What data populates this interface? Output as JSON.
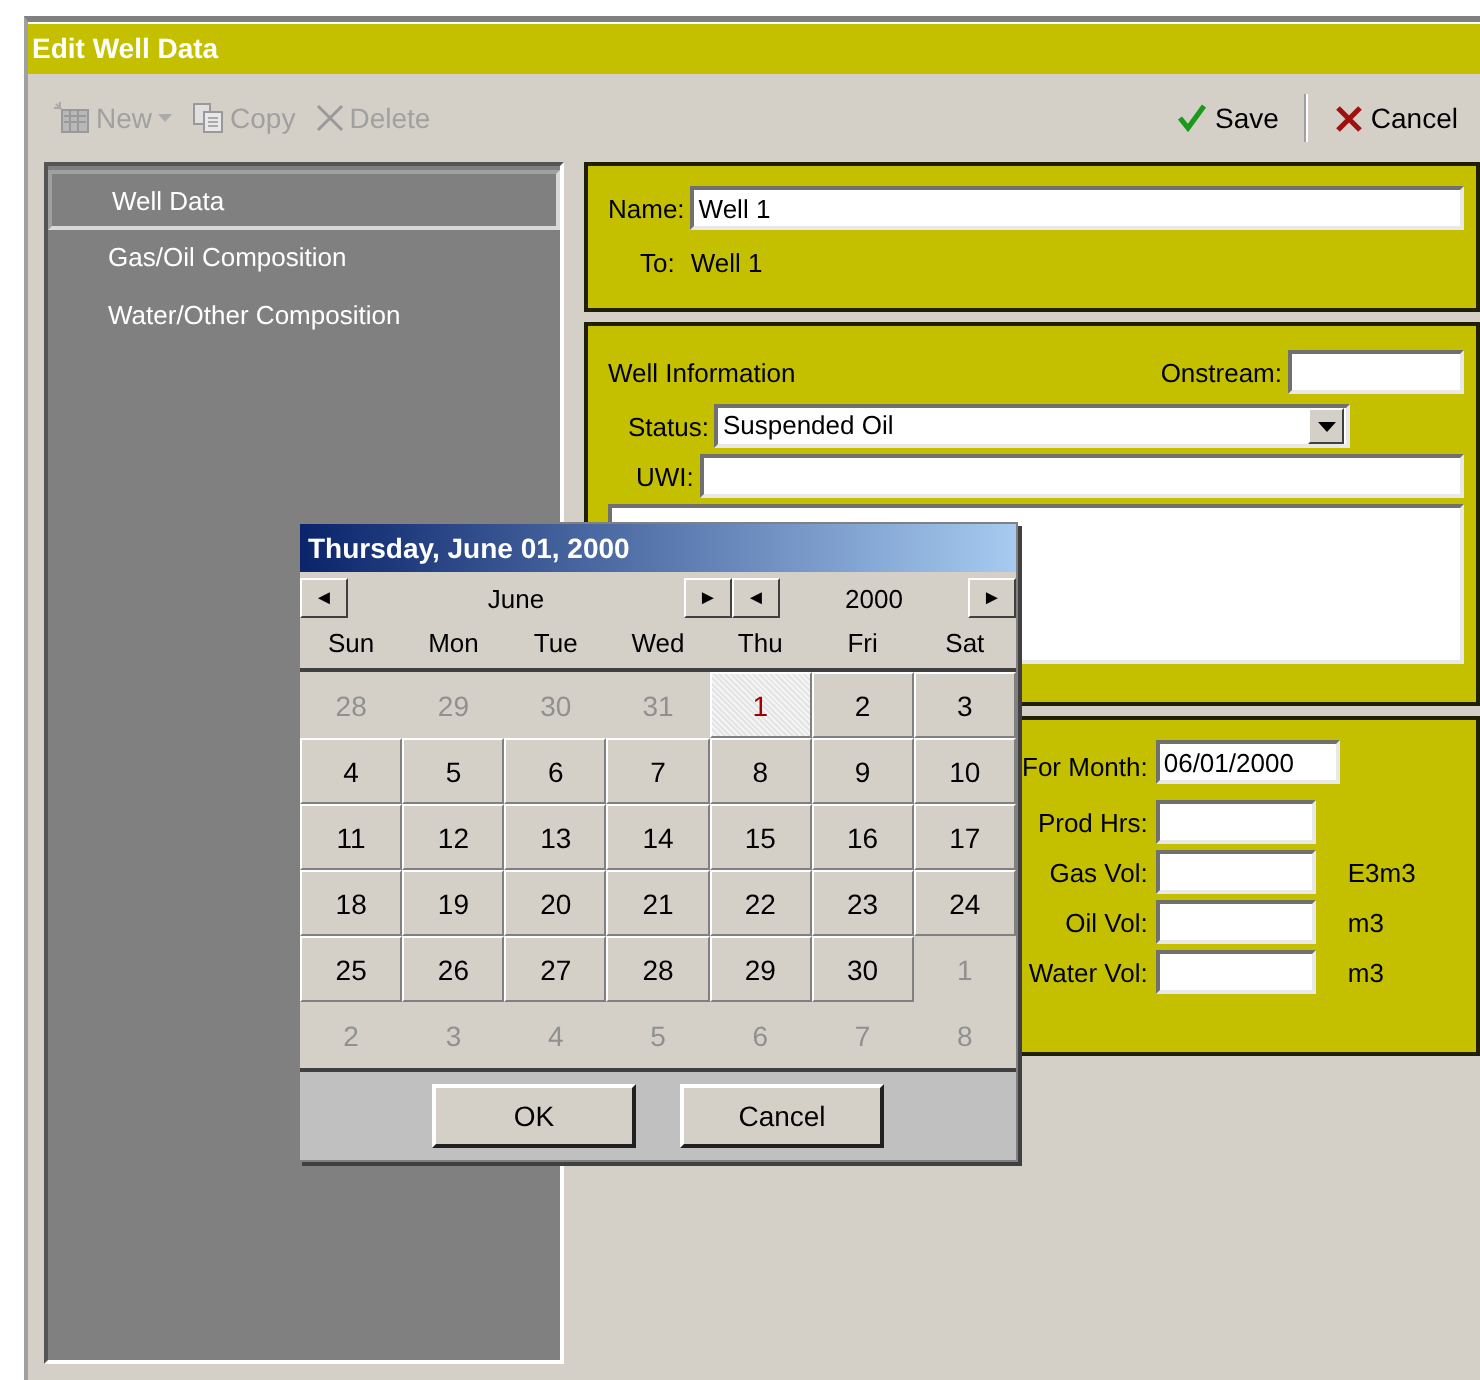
{
  "window": {
    "title": "Edit Well Data"
  },
  "toolbar": {
    "left": [
      {
        "label": "New",
        "kind": "new",
        "disabled": true
      },
      {
        "label": "Copy",
        "kind": "copy",
        "disabled": true
      },
      {
        "label": "Delete",
        "kind": "delete",
        "disabled": true
      }
    ],
    "right": [
      {
        "label": "Save",
        "kind": "save"
      },
      {
        "label": "Cancel",
        "kind": "cancel"
      }
    ]
  },
  "sidebar": {
    "items": [
      {
        "label": "Well Data",
        "selected": true
      },
      {
        "label": "Gas/Oil Composition",
        "selected": false
      },
      {
        "label": "Water/Other Composition",
        "selected": false
      }
    ]
  },
  "name_panel": {
    "name_label": "Name:",
    "name_value": "Well 1",
    "to_label": "To:",
    "to_value": "Well 1"
  },
  "well_info": {
    "heading": "Well Information",
    "onstream_label": "Onstream:",
    "status_label": "Status:",
    "status_value": "Suspended Oil",
    "uwi_label": "UWI:"
  },
  "production": {
    "rows": [
      {
        "label": "For Month:",
        "value": "06/01/2000"
      },
      {
        "label": "Prod Hrs:"
      },
      {
        "label": "Gas Vol:",
        "unit": "E3m3"
      },
      {
        "label": "Oil Vol:",
        "unit": "m3"
      },
      {
        "label": "Water Vol:",
        "unit": "m3"
      }
    ]
  },
  "calendar": {
    "title": "Thursday, June 01, 2000",
    "month": "June",
    "year": "2000",
    "prev": "◄",
    "next": "►",
    "weekdays": [
      "Sun",
      "Mon",
      "Tue",
      "Wed",
      "Thu",
      "Fri",
      "Sat"
    ],
    "days": [
      {
        "day": "28",
        "in_month": false,
        "selected": false
      },
      {
        "day": "29",
        "in_month": false,
        "selected": false
      },
      {
        "day": "30",
        "in_month": false,
        "selected": false
      },
      {
        "day": "31",
        "in_month": false,
        "selected": false
      },
      {
        "day": "1",
        "in_month": true,
        "selected": true
      },
      {
        "day": "2",
        "in_month": true,
        "selected": false
      },
      {
        "day": "3",
        "in_month": true,
        "selected": false
      },
      {
        "day": "4",
        "in_month": true,
        "selected": false
      },
      {
        "day": "5",
        "in_month": true,
        "selected": false
      },
      {
        "day": "6",
        "in_month": true,
        "selected": false
      },
      {
        "day": "7",
        "in_month": true,
        "selected": false
      },
      {
        "day": "8",
        "in_month": true,
        "selected": false
      },
      {
        "day": "9",
        "in_month": true,
        "selected": false
      },
      {
        "day": "10",
        "in_month": true,
        "selected": false
      },
      {
        "day": "11",
        "in_month": true,
        "selected": false
      },
      {
        "day": "12",
        "in_month": true,
        "selected": false
      },
      {
        "day": "13",
        "in_month": true,
        "selected": false
      },
      {
        "day": "14",
        "in_month": true,
        "selected": false
      },
      {
        "day": "15",
        "in_month": true,
        "selected": false
      },
      {
        "day": "16",
        "in_month": true,
        "selected": false
      },
      {
        "day": "17",
        "in_month": true,
        "selected": false
      },
      {
        "day": "18",
        "in_month": true,
        "selected": false
      },
      {
        "day": "19",
        "in_month": true,
        "selected": false
      },
      {
        "day": "20",
        "in_month": true,
        "selected": false
      },
      {
        "day": "21",
        "in_month": true,
        "selected": false
      },
      {
        "day": "22",
        "in_month": true,
        "selected": false
      },
      {
        "day": "23",
        "in_month": true,
        "selected": false
      },
      {
        "day": "24",
        "in_month": true,
        "selected": false
      },
      {
        "day": "25",
        "in_month": true,
        "selected": false
      },
      {
        "day": "26",
        "in_month": true,
        "selected": false
      },
      {
        "day": "27",
        "in_month": true,
        "selected": false
      },
      {
        "day": "28",
        "in_month": true,
        "selected": false
      },
      {
        "day": "29",
        "in_month": true,
        "selected": false
      },
      {
        "day": "30",
        "in_month": true,
        "selected": false
      },
      {
        "day": "1",
        "in_month": false,
        "selected": false
      },
      {
        "day": "2",
        "in_month": false,
        "selected": false
      },
      {
        "day": "3",
        "in_month": false,
        "selected": false
      },
      {
        "day": "4",
        "in_month": false,
        "selected": false
      },
      {
        "day": "5",
        "in_month": false,
        "selected": false
      },
      {
        "day": "6",
        "in_month": false,
        "selected": false
      },
      {
        "day": "7",
        "in_month": false,
        "selected": false
      },
      {
        "day": "8",
        "in_month": false,
        "selected": false
      }
    ],
    "buttons": [
      "OK",
      "Cancel"
    ]
  }
}
